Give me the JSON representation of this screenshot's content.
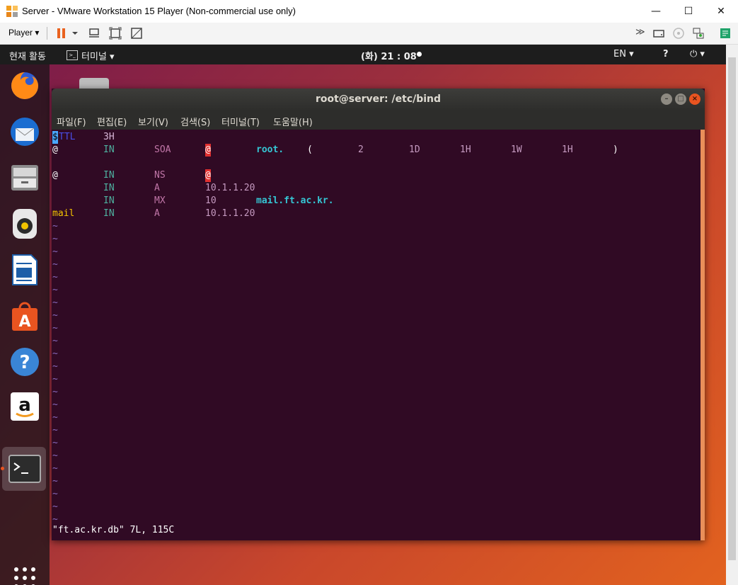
{
  "window": {
    "title": "Server - VMware Workstation 15 Player (Non-commercial use only)",
    "player_label": "Player ▾",
    "minimize": "—",
    "maximize": "☐",
    "close": "✕"
  },
  "topbar": {
    "activities": "현재 활동",
    "app_menu": "터미널 ▾",
    "clock": "(화) 21 : 08",
    "lang": "EN ▾",
    "accessibility": "?",
    "power": "⏻ ▾"
  },
  "terminal": {
    "title": "root@server: /etc/bind",
    "menu": [
      "파일(F)",
      "편집(E)",
      "보기(V)",
      "검색(S)",
      "터미널(T)",
      "도움말(H)"
    ],
    "lines": [
      {
        "cells": [
          {
            "t": "$",
            "cls": "cur"
          },
          {
            "t": "TTL",
            "cls": "tl"
          },
          {
            "t": "3H",
            "cls": "n",
            "col": 8
          }
        ]
      },
      {
        "cells": [
          {
            "t": "@",
            "cls": "w"
          },
          {
            "t": "IN",
            "cls": "g",
            "col": 8
          },
          {
            "t": "SOA",
            "cls": "p",
            "col": 16
          },
          {
            "t": "@",
            "cls": "hl",
            "col": 24
          },
          {
            "t": "root.",
            "cls": "t",
            "col": 32
          },
          {
            "t": "(",
            "cls": "w",
            "col": 40
          },
          {
            "t": "2",
            "cls": "v",
            "col": 48
          },
          {
            "t": "1D",
            "cls": "v",
            "col": 56
          },
          {
            "t": "1H",
            "cls": "v",
            "col": 64
          },
          {
            "t": "1W",
            "cls": "v",
            "col": 72
          },
          {
            "t": "1H",
            "cls": "v",
            "col": 80
          },
          {
            "t": ")",
            "cls": "w",
            "col": 88
          }
        ]
      },
      {
        "cells": []
      },
      {
        "cells": [
          {
            "t": "@",
            "cls": "w"
          },
          {
            "t": "IN",
            "cls": "g",
            "col": 8
          },
          {
            "t": "NS",
            "cls": "p",
            "col": 16
          },
          {
            "t": "@",
            "cls": "hl",
            "col": 24
          }
        ]
      },
      {
        "cells": [
          {
            "t": "IN",
            "cls": "g",
            "col": 8
          },
          {
            "t": "A",
            "cls": "p",
            "col": 16
          },
          {
            "t": "10.1.1.20",
            "cls": "v",
            "col": 24
          }
        ]
      },
      {
        "cells": [
          {
            "t": "IN",
            "cls": "g",
            "col": 8
          },
          {
            "t": "MX",
            "cls": "p",
            "col": 16
          },
          {
            "t": "10",
            "cls": "v",
            "col": 24
          },
          {
            "t": "mail.ft.ac.kr.",
            "cls": "t",
            "col": 32
          }
        ]
      },
      {
        "cells": [
          {
            "t": "mail",
            "cls": "y"
          },
          {
            "t": "IN",
            "cls": "g",
            "col": 8
          },
          {
            "t": "A",
            "cls": "p",
            "col": 16
          },
          {
            "t": "10.1.1.20",
            "cls": "v",
            "col": 24
          }
        ]
      }
    ],
    "tilde_count": 24,
    "status": "\"ft.ac.kr.db\" 7L, 115C"
  },
  "dock": [
    "firefox-icon",
    "thunderbird-icon",
    "files-icon",
    "rhythmbox-icon",
    "libreoffice-writer-icon",
    "software-center-icon",
    "help-icon",
    "amazon-icon",
    "terminal-icon",
    "app-grid-icon"
  ],
  "colors": {
    "accent": "#e95420",
    "terminal_bg": "#300a24"
  }
}
